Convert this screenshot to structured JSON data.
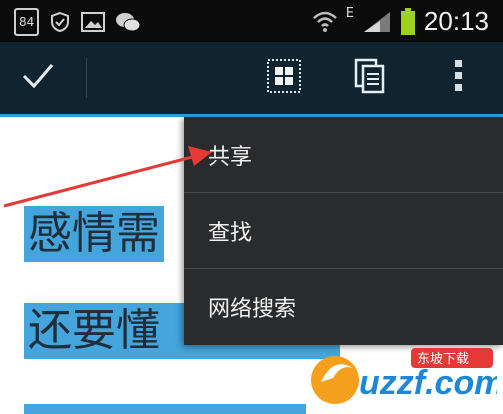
{
  "status_bar": {
    "badge": "84",
    "network_type": "E",
    "time": "20:13"
  },
  "action_bar": {
    "icons": [
      "check-icon",
      "select-all-icon",
      "copy-icon",
      "overflow-menu-icon"
    ]
  },
  "document": {
    "lines": [
      "感情需",
      "还要懂"
    ]
  },
  "menu": {
    "items": [
      "共享",
      "查找",
      "网络搜索"
    ]
  },
  "watermark": {
    "brand": "uzzf.com",
    "tag": "东坡下载"
  },
  "colors": {
    "status_bar": "#0b0b0b",
    "action_bar": "#10242f",
    "highlight": "#44a4dc",
    "menu_bg": "#2a2b2c",
    "arrow": "#e53935"
  }
}
